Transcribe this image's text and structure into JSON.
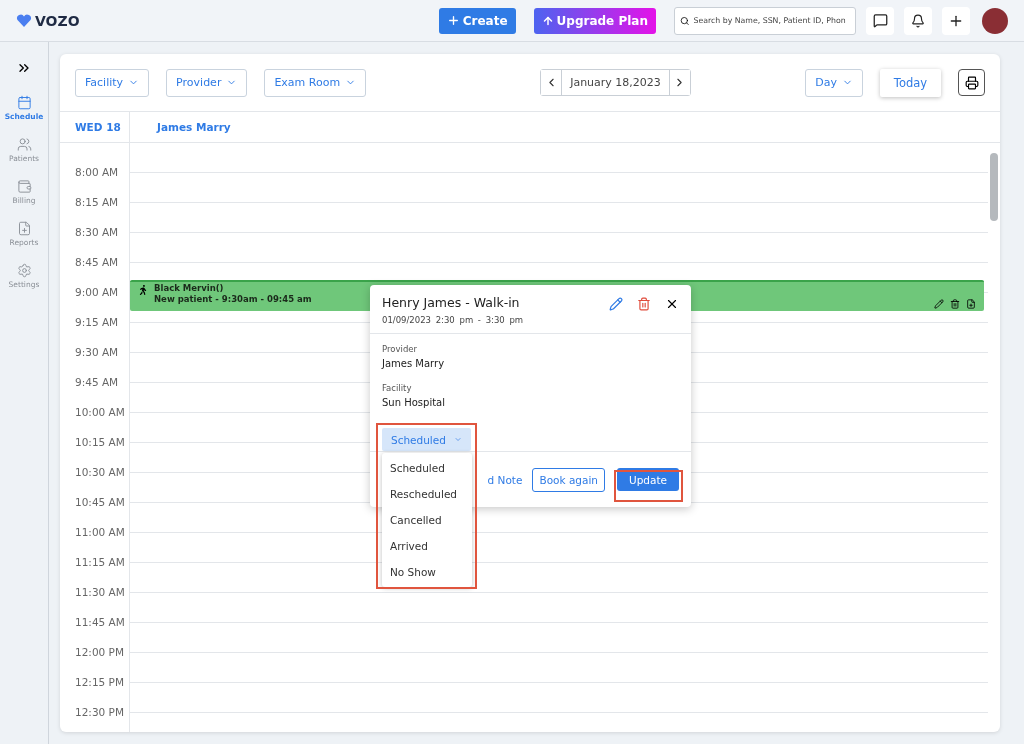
{
  "header": {
    "logo": "VOZO",
    "create_button": "Create",
    "upgrade_button": "Upgrade Plan",
    "search": {
      "placeholder": "Search by Name, SSN, Patient ID, Phon"
    }
  },
  "sidebar": {
    "items": [
      {
        "label": "Schedule",
        "kind": "calendar",
        "selected": true
      },
      {
        "label": "Patients",
        "kind": "patients",
        "selected": false
      },
      {
        "label": "Billing",
        "kind": "billing",
        "selected": false
      },
      {
        "label": "Reports",
        "kind": "reports",
        "selected": false
      },
      {
        "label": "Settings",
        "kind": "settings",
        "selected": false
      }
    ]
  },
  "toolbar": {
    "filters": [
      "Facility",
      "Provider",
      "Exam Room"
    ],
    "date": "January 18,2023",
    "view": "Day",
    "today_button": "Today"
  },
  "calendar": {
    "day": "WED 18",
    "provider": "James Marry",
    "times": [
      "8:00 AM",
      "8:15 AM",
      "8:30 AM",
      "8:45 AM",
      "9:00 AM",
      "9:15 AM",
      "9:30 AM",
      "9:45 AM",
      "10:00 AM",
      "10:15 AM",
      "10:30 AM",
      "10:45 AM",
      "11:00 AM",
      "11:15 AM",
      "11:30 AM",
      "11:45 AM",
      "12:00 PM",
      "12:15 PM",
      "12:30 PM"
    ],
    "event": {
      "name": "Black Mervin()",
      "detail": "New patient - 9:30am - 09:45 am",
      "color": "#6fc77a"
    }
  },
  "popup": {
    "title": "Henry James - Walk-in",
    "date": "01/09/2023",
    "time": "2:30 pm - 3:30 pm",
    "fields": [
      {
        "label": "Provider",
        "value": "James Marry"
      },
      {
        "label": "Facility",
        "value": "Sun Hospital"
      }
    ],
    "status": "Scheduled",
    "status_options": [
      "Scheduled",
      "Rescheduled",
      "Cancelled",
      "Arrived",
      "No Show"
    ],
    "note_link": "d Note",
    "book_again_button": "Book again",
    "update_button": "Update"
  }
}
